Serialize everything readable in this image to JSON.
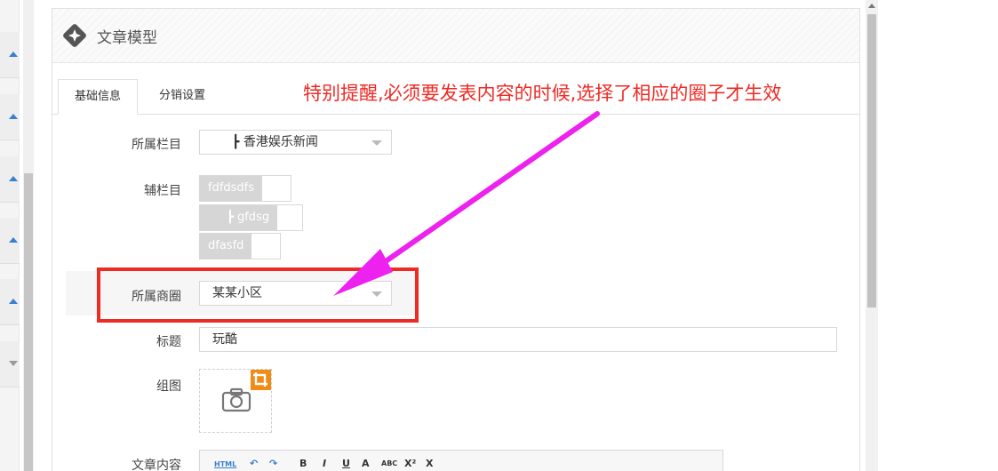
{
  "panel": {
    "title": "文章模型"
  },
  "tabs": [
    {
      "label": "基础信息",
      "active": true
    },
    {
      "label": "分销设置",
      "active": false
    }
  ],
  "notice": "特别提醒,必须要发表内容的时候,选择了相应的圈子才生效",
  "form": {
    "category": {
      "label": "所属栏目",
      "value": "┣ 香港娱乐新闻"
    },
    "sub_category": {
      "label": "辅栏目",
      "options": [
        "fdfdsdfs",
        "┣ gfdsg",
        "dfasfd"
      ]
    },
    "business_circle": {
      "label": "所属商圈",
      "value": "某某小区"
    },
    "title": {
      "label": "标题",
      "value": "玩酷"
    },
    "gallery": {
      "label": "组图"
    },
    "content": {
      "label": "文章内容"
    }
  },
  "editor_toolbar": [
    "HTML",
    "↶",
    "↷",
    "B",
    "I",
    "U",
    "A",
    "ABC",
    "X²",
    "X"
  ],
  "colors": {
    "notice": "#ee2a24",
    "highlight_frame": "#ee2a24",
    "arrow": "#ee22ee",
    "crop_badge": "#f08c16",
    "accent": "#3a7fd0"
  },
  "icons": [
    "diamond-logo-icon",
    "camera-icon",
    "crop-icon",
    "caret-down-icon"
  ]
}
